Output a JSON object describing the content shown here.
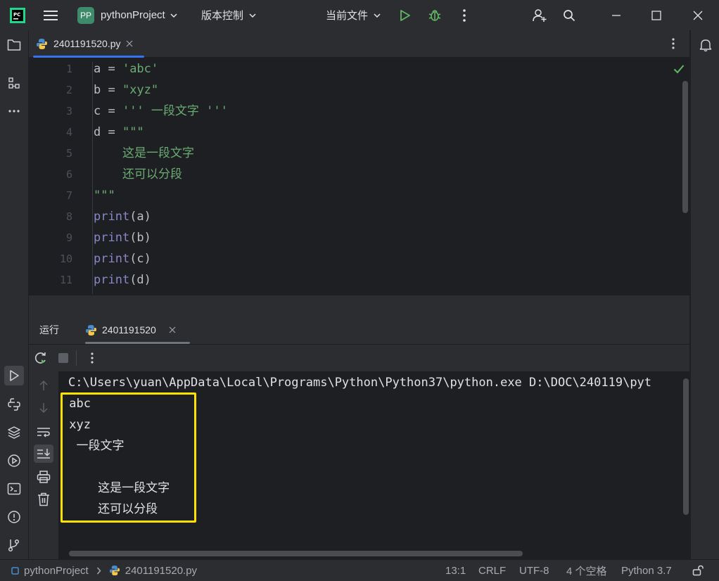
{
  "titlebar": {
    "project_badge": "PP",
    "project_name": "pythonProject",
    "vcs_label": "版本控制",
    "run_config": "当前文件"
  },
  "editor": {
    "tab_label": "2401191520.py",
    "line_numbers": [
      "1",
      "2",
      "3",
      "4",
      "5",
      "6",
      "7",
      "8",
      "9",
      "10",
      "11"
    ],
    "lines": [
      {
        "a": "a = ",
        "b": "'abc'"
      },
      {
        "a": "b = ",
        "b": "\"xyz\""
      },
      {
        "a": "c = ",
        "b": "''' 一段文字 '''"
      },
      {
        "a": "d = ",
        "b": "\"\"\""
      },
      {
        "a": "",
        "b": "    这是一段文字"
      },
      {
        "a": "",
        "b": "    还可以分段"
      },
      {
        "a": "",
        "b": "\"\"\""
      },
      {
        "fn": "print",
        "rest": "(a)"
      },
      {
        "fn": "print",
        "rest": "(b)"
      },
      {
        "fn": "print",
        "rest": "(c)"
      },
      {
        "fn": "print",
        "rest": "(d)"
      }
    ]
  },
  "run_panel": {
    "tab_run": "运行",
    "tab_config": "2401191520",
    "command_line": "C:\\Users\\yuan\\AppData\\Local\\Programs\\Python\\Python37\\python.exe D:\\DOC\\240119\\pyt",
    "output": [
      " abc",
      " xyz",
      "  一段文字",
      "",
      "     这是一段文字",
      "     还可以分段"
    ]
  },
  "statusbar": {
    "project": "pythonProject",
    "file": "2401191520.py",
    "position": "13:1",
    "line_sep": "CRLF",
    "encoding": "UTF-8",
    "indent": "4 个空格",
    "interpreter": "Python 3.7"
  },
  "colors": {
    "accent": "#3574f0",
    "highlight_box": "#ffe100",
    "string": "#6aab73",
    "builtin": "#8888c6",
    "run_green": "#5fb865"
  }
}
